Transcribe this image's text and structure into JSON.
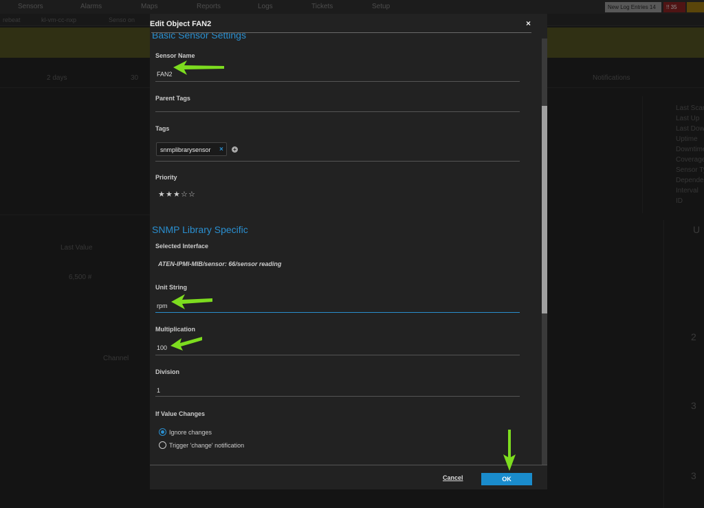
{
  "background": {
    "nav": [
      "Sensors",
      "Alarms",
      "Maps",
      "Reports",
      "Logs",
      "Tickets",
      "Setup"
    ],
    "log_button": "New Log Entries 14",
    "alarm_count": "35",
    "tabs": [
      "rebeat",
      "kl-vm-cc-nxp",
      "Senso on"
    ],
    "panel_labels": [
      "Last Scan",
      "Last Up",
      "Last Down",
      "Uptime",
      "Downtime",
      "Coverage",
      "Sensor Ty",
      "Dependen",
      "Interval",
      "ID"
    ],
    "channel_header": "Last Value",
    "channel_value": "6,500 #",
    "channel_label": "Channel",
    "notifications": "Notifications",
    "days": "2 days",
    "days_short": "30"
  },
  "modal": {
    "title": "Edit Object FAN2",
    "close_glyph": "×",
    "sections": {
      "basic": "Basic Sensor Settings",
      "snmp": "SNMP Library Specific"
    },
    "fields": {
      "sensor_name": {
        "label": "Sensor Name",
        "value": "FAN2"
      },
      "parent_tags": {
        "label": "Parent Tags",
        "value": ""
      },
      "tags": {
        "label": "Tags",
        "items": [
          "snmplibrarysensor"
        ],
        "remove_glyph": "×",
        "add_glyph": "+"
      },
      "priority": {
        "label": "Priority",
        "value": 3,
        "max": 5,
        "filled_glyph": "★",
        "empty_glyph": "☆"
      },
      "selected_interface": {
        "label": "Selected Interface",
        "value": "ATEN-IPMI-MIB/sensor: 66/sensor reading"
      },
      "unit_string": {
        "label": "Unit String",
        "value": "rpm"
      },
      "multiplication": {
        "label": "Multiplication",
        "value": "100"
      },
      "division": {
        "label": "Division",
        "value": "1"
      },
      "if_value_changes": {
        "label": "If Value Changes",
        "options": [
          "Ignore changes",
          "Trigger 'change' notification"
        ],
        "selected": "Ignore changes"
      }
    },
    "buttons": {
      "cancel": "Cancel",
      "ok": "OK"
    }
  },
  "colors": {
    "accent": "#2a8fd0",
    "ok_button": "#1a8ccc",
    "annotation_arrow": "#7ddc1f"
  }
}
